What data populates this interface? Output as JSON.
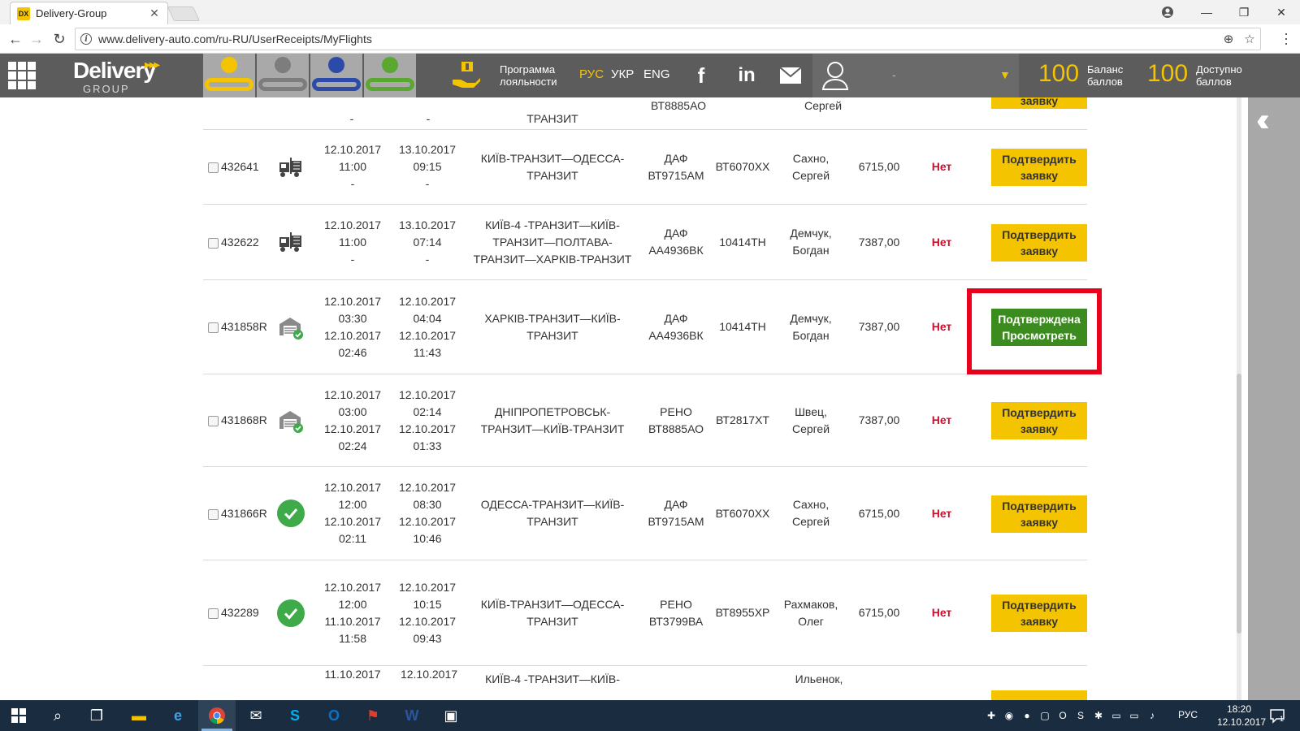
{
  "browser": {
    "tab_title": "Delivery-Group",
    "tab_favicon": "DX",
    "url": "www.delivery-auto.com/ru-RU/UserReceipts/MyFlights"
  },
  "header": {
    "logo_main": "Delivery",
    "logo_sub": "GROUP",
    "loyalty_line1": "Программа",
    "loyalty_line2": "лояльности",
    "languages": [
      "РУС",
      "УКР",
      "ENG"
    ],
    "user_name": "-",
    "balance_value": "100",
    "balance_label1": "Баланс",
    "balance_label2": "баллов",
    "available_value": "100",
    "available_label1": "Доступно",
    "available_label2": "баллов",
    "colors": {
      "accent": "#f5c400",
      "header_bg": "#5c5c5c",
      "confirmed": "#3c8b1e",
      "status_no": "#c8102e"
    }
  },
  "partial_top_row": {
    "dash1": "-",
    "dash2": "-",
    "route": "ТРАНЗИТ",
    "truck": "ВТ8885АО",
    "driver": "Сергей",
    "button": "заявку"
  },
  "rows": [
    {
      "id": "432641",
      "icon": "forklift-icon",
      "start": [
        "12.10.2017",
        "11:00",
        "-"
      ],
      "end": [
        "13.10.2017",
        "09:15",
        "-"
      ],
      "route": [
        "КИЇВ-ТРАНЗИТ—ОДЕССА-",
        "ТРАНЗИТ"
      ],
      "truck": [
        "ДАФ",
        "ВТ9715АМ"
      ],
      "trailer": "ВТ6070ХХ",
      "driver": [
        "Сахно,",
        "Сергей"
      ],
      "amount": "6715,00",
      "status": "Нет",
      "button": [
        "Подтвердить",
        "заявку"
      ],
      "confirmed": false
    },
    {
      "id": "432622",
      "icon": "forklift-icon",
      "start": [
        "12.10.2017",
        "11:00",
        "-"
      ],
      "end": [
        "13.10.2017",
        "07:14",
        "-"
      ],
      "route": [
        "КИЇВ-4 -ТРАНЗИТ—КИЇВ-",
        "ТРАНЗИТ—ПОЛТАВА-",
        "ТРАНЗИТ—ХАРКІВ-ТРАНЗИТ"
      ],
      "truck": [
        "ДАФ",
        "АА4936ВК"
      ],
      "trailer": "10414ТН",
      "driver": [
        "Демчук,",
        "Богдан"
      ],
      "amount": "7387,00",
      "status": "Нет",
      "button": [
        "Подтвердить",
        "заявку"
      ],
      "confirmed": false
    },
    {
      "id": "431858R",
      "icon": "warehouse-check-icon",
      "start": [
        "12.10.2017",
        "03:30",
        "12.10.2017",
        "02:46"
      ],
      "end": [
        "12.10.2017",
        "04:04",
        "12.10.2017",
        "11:43"
      ],
      "route": [
        "ХАРКІВ-ТРАНЗИТ—КИЇВ-",
        "ТРАНЗИТ"
      ],
      "truck": [
        "ДАФ",
        "АА4936ВК"
      ],
      "trailer": "10414ТН",
      "driver": [
        "Демчук,",
        "Богдан"
      ],
      "amount": "7387,00",
      "status": "Нет",
      "button": [
        "Подтверждена",
        "Просмотреть"
      ],
      "confirmed": true
    },
    {
      "id": "431868R",
      "icon": "warehouse-check-icon",
      "start": [
        "12.10.2017",
        "03:00",
        "12.10.2017",
        "02:24"
      ],
      "end": [
        "12.10.2017",
        "02:14",
        "12.10.2017",
        "01:33"
      ],
      "route": [
        "ДНІПРОПЕТРОВСЬК-",
        "ТРАНЗИТ—КИЇВ-ТРАНЗИТ"
      ],
      "truck": [
        "РЕНО",
        "ВТ8885АО"
      ],
      "trailer": "ВТ2817ХТ",
      "driver": [
        "Швец,",
        "Сергей"
      ],
      "amount": "7387,00",
      "status": "Нет",
      "button": [
        "Подтвердить",
        "заявку"
      ],
      "confirmed": false
    },
    {
      "id": "431866R",
      "icon": "check-circle-icon",
      "start": [
        "12.10.2017",
        "12:00",
        "12.10.2017",
        "02:11"
      ],
      "end": [
        "12.10.2017",
        "08:30",
        "12.10.2017",
        "10:46"
      ],
      "route": [
        "ОДЕССА-ТРАНЗИТ—КИЇВ-",
        "ТРАНЗИТ"
      ],
      "truck": [
        "ДАФ",
        "ВТ9715АМ"
      ],
      "trailer": "ВТ6070ХХ",
      "driver": [
        "Сахно,",
        "Сергей"
      ],
      "amount": "6715,00",
      "status": "Нет",
      "button": [
        "Подтвердить",
        "заявку"
      ],
      "confirmed": false
    },
    {
      "id": "432289",
      "icon": "check-circle-icon",
      "start": [
        "12.10.2017",
        "12:00",
        "11.10.2017",
        "11:58"
      ],
      "end": [
        "12.10.2017",
        "10:15",
        "12.10.2017",
        "09:43"
      ],
      "route": [
        "КИЇВ-ТРАНЗИТ—ОДЕССА-",
        "ТРАНЗИТ"
      ],
      "truck": [
        "РЕНО",
        "ВТ3799ВА"
      ],
      "trailer": "ВТ8955ХР",
      "driver": [
        "Рахмаков,",
        "Олег"
      ],
      "amount": "6715,00",
      "status": "Нет",
      "button": [
        "Подтвердить",
        "заявку"
      ],
      "confirmed": false
    }
  ],
  "partial_bottom_row": {
    "start": "11.10.2017",
    "end": "12.10.2017",
    "route": "КИЇВ-4 -ТРАНЗИТ—КИЇВ-",
    "driver": "Ильенок,"
  },
  "taskbar": {
    "lang": "РУС",
    "time": "18:20",
    "date": "12.10.2017",
    "notification_count": "1"
  }
}
